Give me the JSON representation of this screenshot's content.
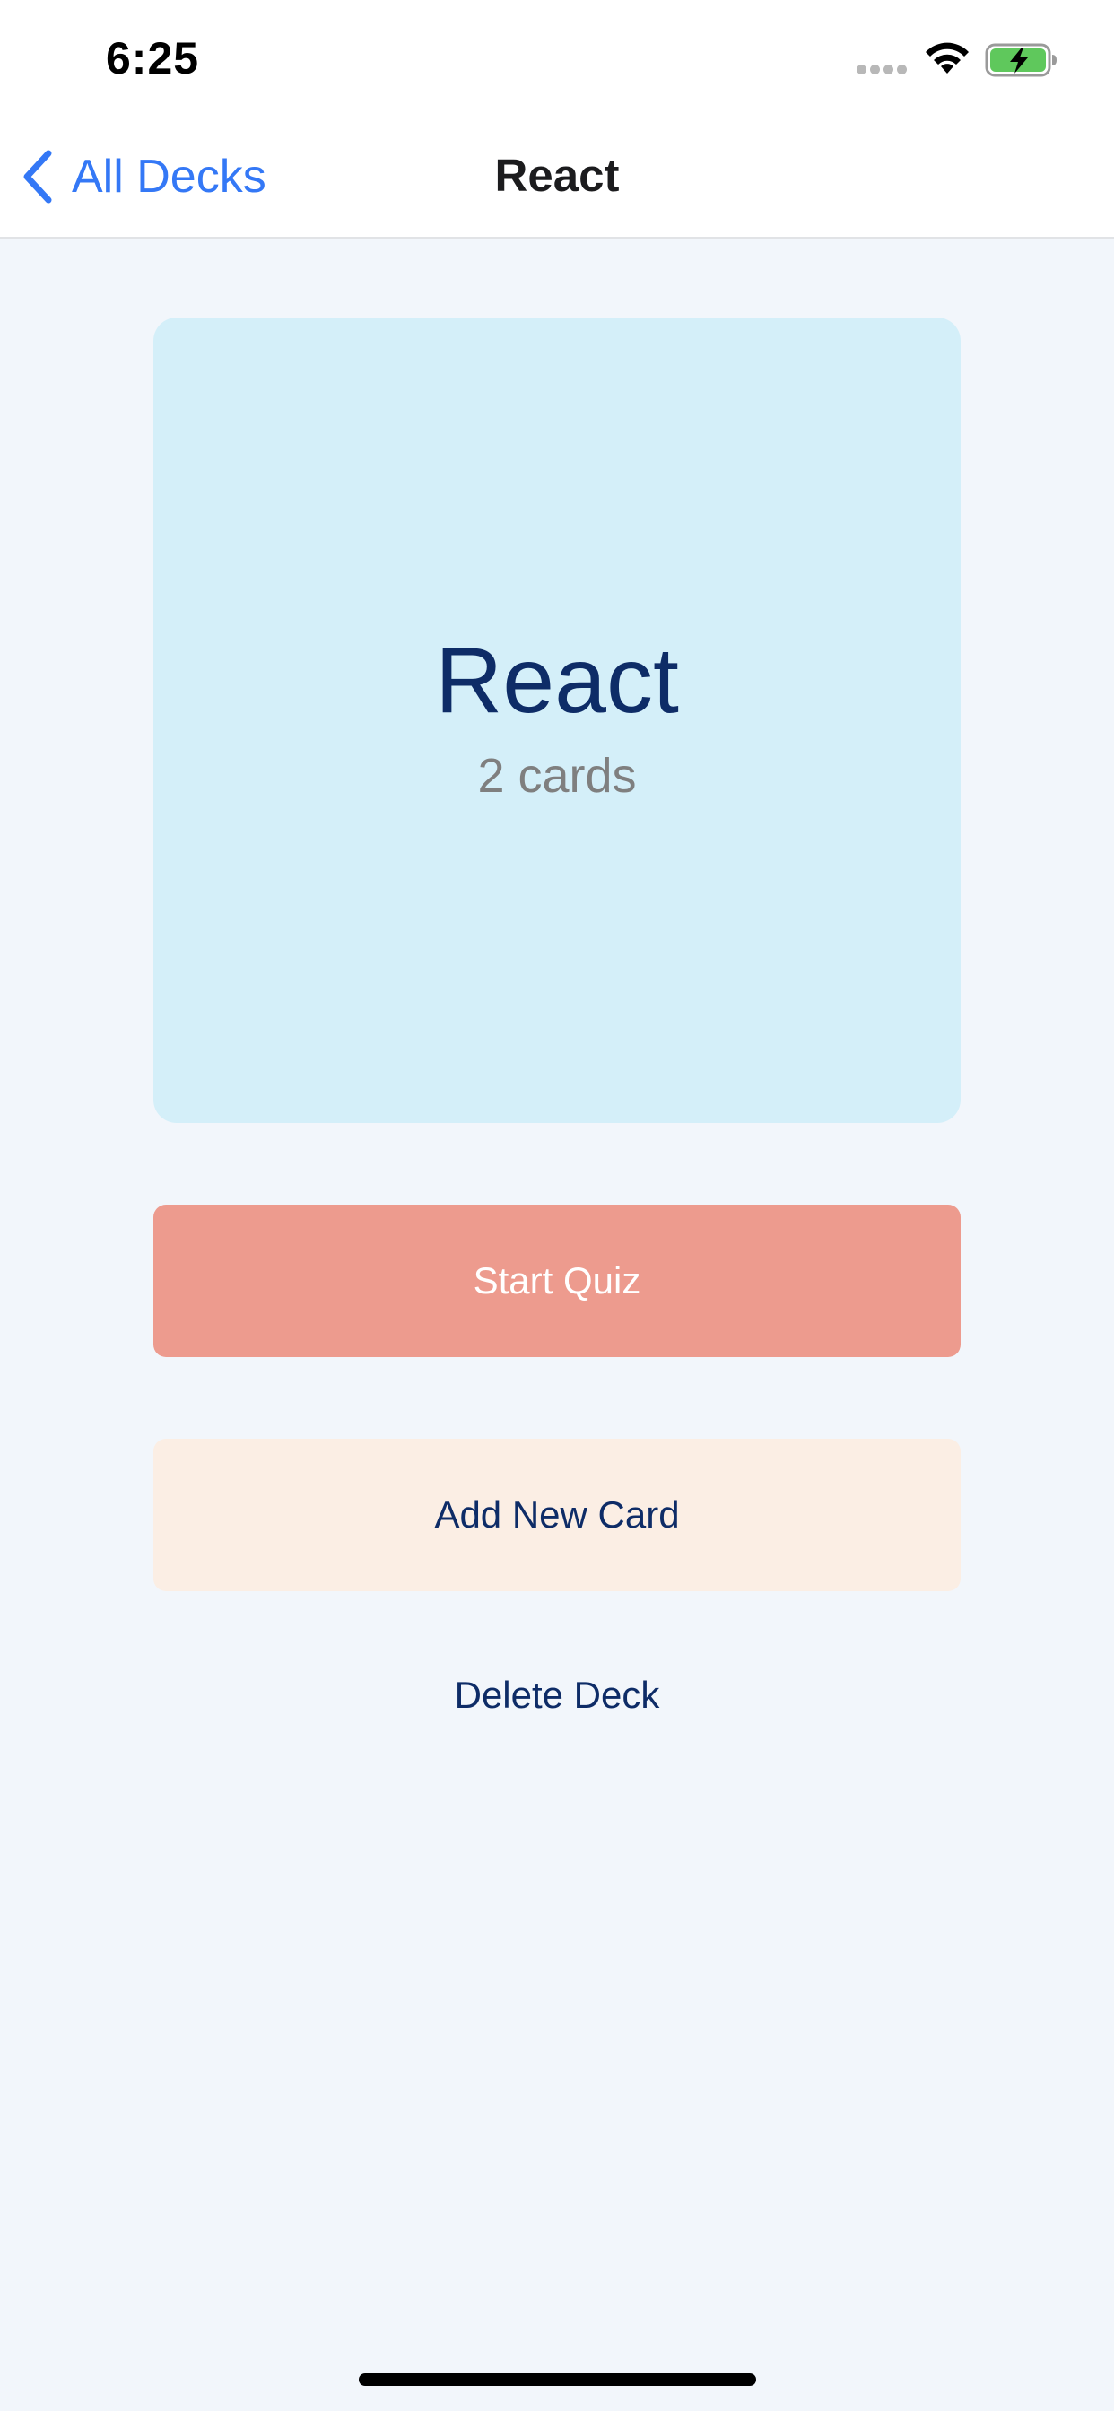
{
  "status_bar": {
    "time": "6:25"
  },
  "nav": {
    "back_label": "All Decks",
    "title": "React"
  },
  "deck": {
    "title": "React",
    "card_count": "2 cards"
  },
  "actions": {
    "start_quiz": "Start Quiz",
    "add_card": "Add New Card",
    "delete_deck": "Delete Deck"
  },
  "colors": {
    "accent_blue": "#3478f6",
    "deck_card_bg": "#d4eff9",
    "start_quiz_bg": "#ed9b8e",
    "add_card_bg": "#fbeee4",
    "text_navy": "#0e2c67",
    "background": "#f2f6fb",
    "battery_green": "#5fc85c"
  },
  "icons": {
    "back": "chevron-left-icon",
    "wifi": "wifi-icon",
    "battery": "battery-charging-icon",
    "signal": "cellular-signal-icon"
  }
}
